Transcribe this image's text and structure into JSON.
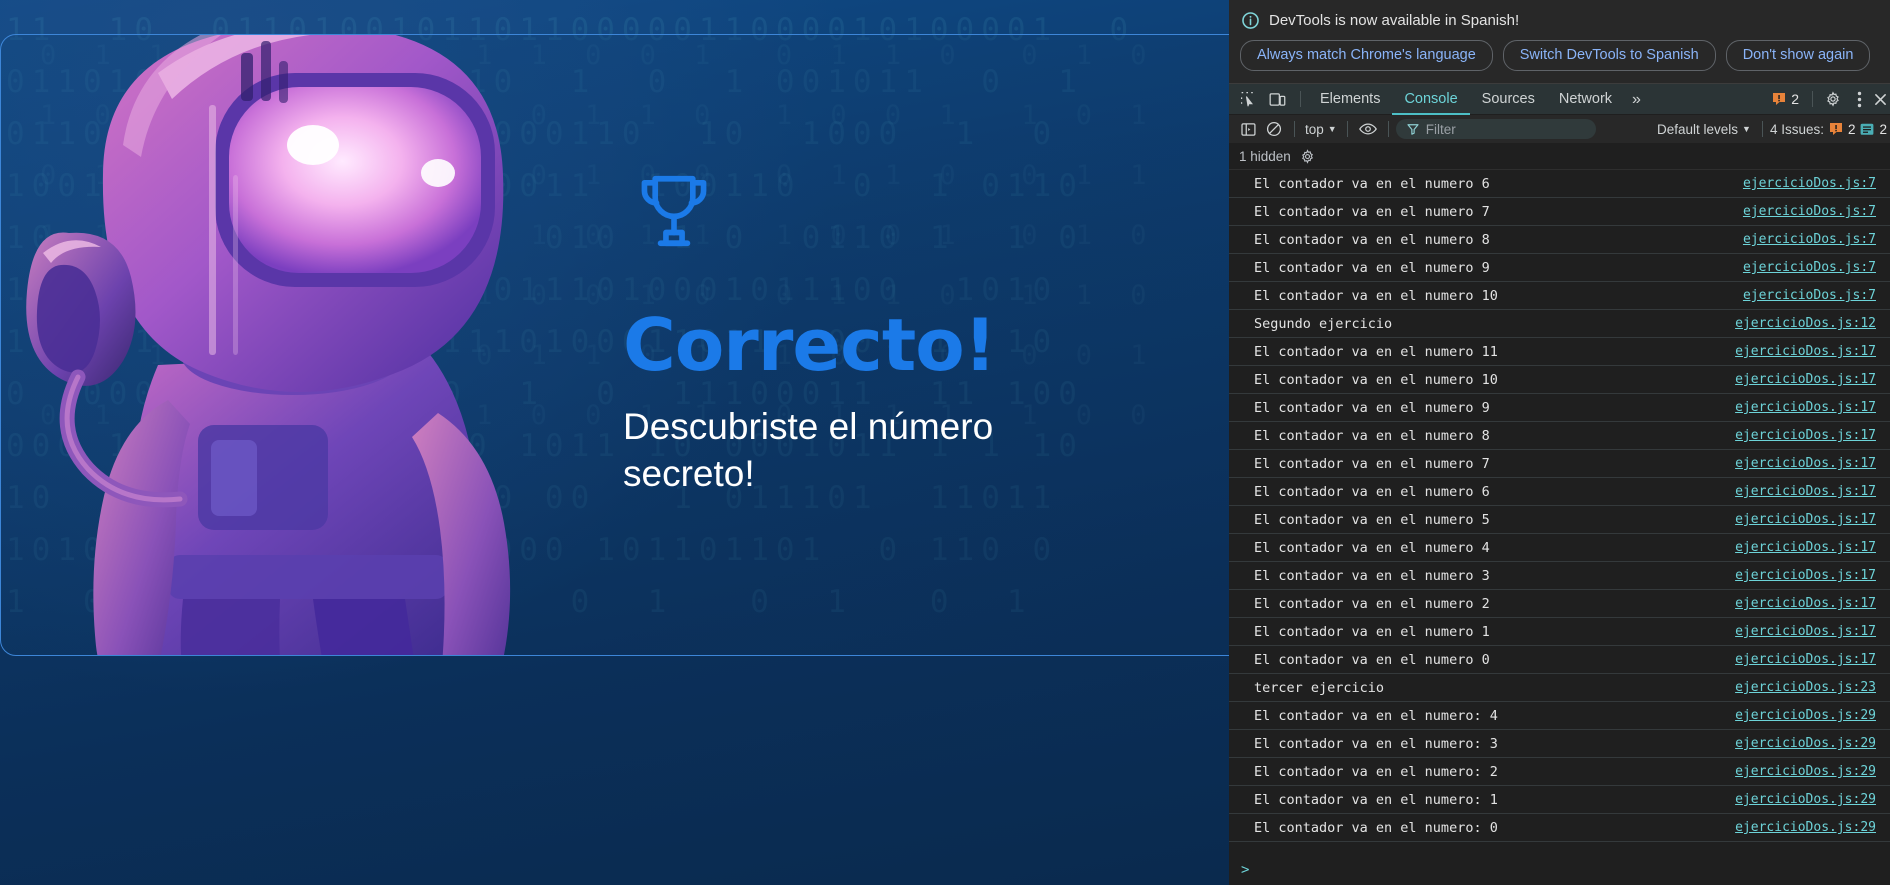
{
  "game": {
    "headline": "Correcto!",
    "subtitle": "Descubriste el número secreto!",
    "trophy_icon": "trophy-icon",
    "robot_icon": "astronaut-robot-illustration",
    "accent_color": "#1b7ae8",
    "background_color": "#0d3a6b",
    "binary_texture_line_a": "11  10  011010010110110000011000010100001  0",
    "binary_texture_line_b": "0110100100101  10010  1  0  1 001011  0  1"
  },
  "devtools": {
    "locale_notice": {
      "message": "DevTools is now available in Spanish!",
      "info_icon": "info-circle-icon",
      "buttons": [
        "Always match Chrome's language",
        "Switch DevTools to Spanish",
        "Don't show again"
      ]
    },
    "tabbar": {
      "inspect_icon": "inspect-element-icon",
      "device_icon": "device-toolbar-icon",
      "tabs": [
        {
          "label": "Elements",
          "active": false
        },
        {
          "label": "Console",
          "active": true
        },
        {
          "label": "Sources",
          "active": false
        },
        {
          "label": "Network",
          "active": false
        }
      ],
      "more_tabs_label": "»",
      "warning_badge_icon": "warning-badge-icon",
      "warning_count": "2",
      "settings_icon": "gear-icon",
      "more_options_icon": "kebab-menu-icon",
      "close_icon": "close-icon"
    },
    "console_toolbar": {
      "sidebar_icon": "console-sidebar-icon",
      "clear_icon": "clear-console-icon",
      "context": "top",
      "eye_icon": "live-expression-icon",
      "filter_icon": "filter-funnel-icon",
      "filter_value": "",
      "filter_placeholder": "Filter",
      "levels_label": "Default levels",
      "issues_label": "4 Issues:",
      "issues_warning_count": "2",
      "issues_info_count": "2",
      "issues_warning_icon": "warning-badge-icon",
      "issues_info_icon": "info-badge-icon"
    },
    "hidden_row": {
      "label": "1 hidden",
      "settings_icon": "console-settings-gear-icon"
    },
    "prompt": ">",
    "messages": [
      {
        "text": "El contador va en el numero 6",
        "source": "ejercicioDos.js:7"
      },
      {
        "text": "El contador va en el numero 7",
        "source": "ejercicioDos.js:7"
      },
      {
        "text": "El contador va en el numero 8",
        "source": "ejercicioDos.js:7"
      },
      {
        "text": "El contador va en el numero 9",
        "source": "ejercicioDos.js:7"
      },
      {
        "text": "El contador va en el numero 10",
        "source": "ejercicioDos.js:7"
      },
      {
        "text": "Segundo ejercicio",
        "source": "ejercicioDos.js:12"
      },
      {
        "text": "El contador va en el numero 11",
        "source": "ejercicioDos.js:17"
      },
      {
        "text": "El contador va en el numero 10",
        "source": "ejercicioDos.js:17"
      },
      {
        "text": "El contador va en el numero 9",
        "source": "ejercicioDos.js:17"
      },
      {
        "text": "El contador va en el numero 8",
        "source": "ejercicioDos.js:17"
      },
      {
        "text": "El contador va en el numero 7",
        "source": "ejercicioDos.js:17"
      },
      {
        "text": "El contador va en el numero 6",
        "source": "ejercicioDos.js:17"
      },
      {
        "text": "El contador va en el numero 5",
        "source": "ejercicioDos.js:17"
      },
      {
        "text": "El contador va en el numero 4",
        "source": "ejercicioDos.js:17"
      },
      {
        "text": "El contador va en el numero 3",
        "source": "ejercicioDos.js:17"
      },
      {
        "text": "El contador va en el numero 2",
        "source": "ejercicioDos.js:17"
      },
      {
        "text": "El contador va en el numero 1",
        "source": "ejercicioDos.js:17"
      },
      {
        "text": "El contador va en el numero 0",
        "source": "ejercicioDos.js:17"
      },
      {
        "text": "tercer ejercicio",
        "source": "ejercicioDos.js:23"
      },
      {
        "text": "El contador va en el numero: 4",
        "source": "ejercicioDos.js:29"
      },
      {
        "text": "El contador va en el numero: 3",
        "source": "ejercicioDos.js:29"
      },
      {
        "text": "El contador va en el numero: 2",
        "source": "ejercicioDos.js:29"
      },
      {
        "text": "El contador va en el numero: 1",
        "source": "ejercicioDos.js:29"
      },
      {
        "text": "El contador va en el numero: 0",
        "source": "ejercicioDos.js:29"
      }
    ]
  }
}
